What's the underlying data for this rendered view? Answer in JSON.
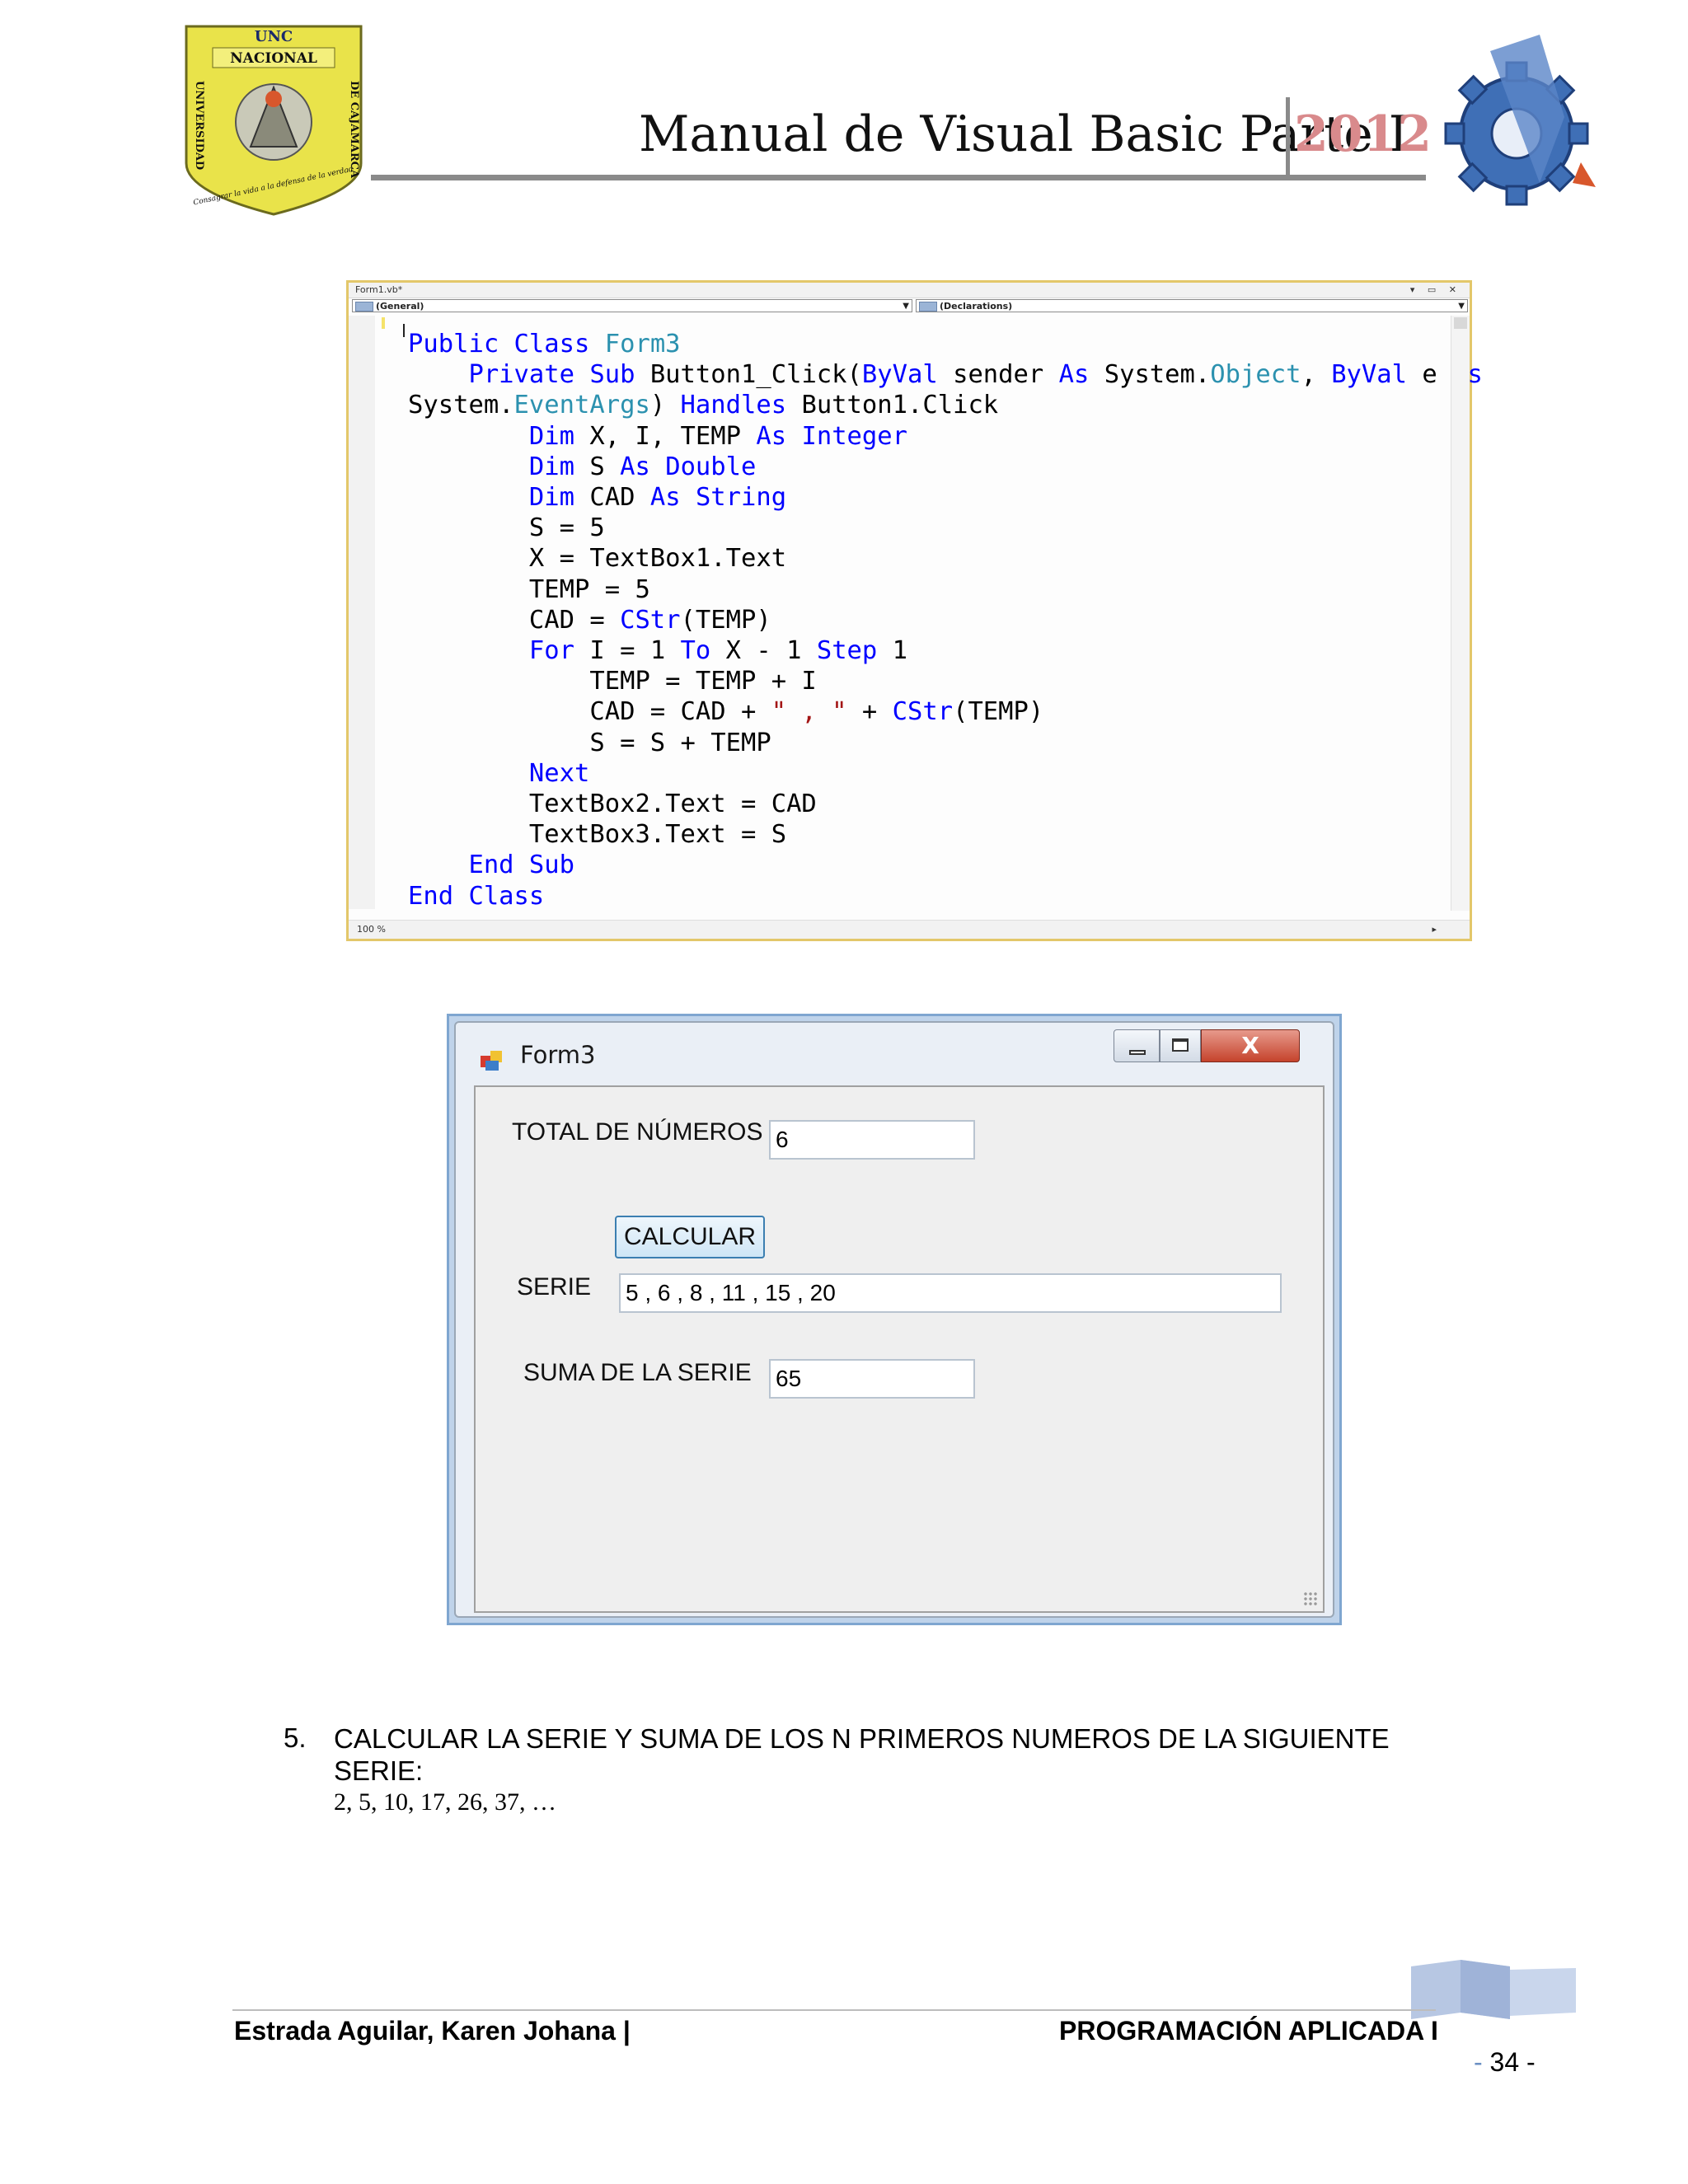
{
  "header": {
    "title": "Manual de Visual Basic Parte I",
    "year": "2012",
    "logo_left": {
      "icon": "unc-university-crest",
      "text_top": "UNC",
      "text_band": "NACIONAL",
      "text_left": "UNIVERSIDAD",
      "text_right": "DE CAJAMARCA",
      "motto": "Consagrar la vida a la defensa de la verdad"
    },
    "logo_right": {
      "icon": "systems-engineering-gear-emblem"
    }
  },
  "editor": {
    "tab_title": "Form1.vb*",
    "left_combo": "(General)",
    "right_combo": "(Declarations)",
    "zoom": "100 %",
    "code_lines": [
      [
        {
          "t": "Public ",
          "c": "kw"
        },
        {
          "t": "Class ",
          "c": "kw"
        },
        {
          "t": "Form3",
          "c": "ty"
        }
      ],
      [
        {
          "t": "    "
        },
        {
          "t": "Private ",
          "c": "kw"
        },
        {
          "t": "Sub ",
          "c": "kw"
        },
        {
          "t": "Button1_Click("
        },
        {
          "t": "ByVal",
          "c": "kw"
        },
        {
          "t": " sender "
        },
        {
          "t": "As",
          "c": "kw"
        },
        {
          "t": " System."
        },
        {
          "t": "Object",
          "c": "ty"
        },
        {
          "t": ", "
        },
        {
          "t": "ByVal",
          "c": "kw"
        },
        {
          "t": " e "
        },
        {
          "t": "As",
          "c": "kw"
        }
      ],
      [
        {
          "t": "System."
        },
        {
          "t": "EventArgs",
          "c": "ty"
        },
        {
          "t": ") "
        },
        {
          "t": "Handles",
          "c": "kw"
        },
        {
          "t": " Button1.Click"
        }
      ],
      [
        {
          "t": "        "
        },
        {
          "t": "Dim",
          "c": "kw"
        },
        {
          "t": " X, I, TEMP "
        },
        {
          "t": "As",
          "c": "kw"
        },
        {
          "t": " "
        },
        {
          "t": "Integer",
          "c": "kw"
        }
      ],
      [
        {
          "t": "        "
        },
        {
          "t": "Dim",
          "c": "kw"
        },
        {
          "t": " S "
        },
        {
          "t": "As",
          "c": "kw"
        },
        {
          "t": " "
        },
        {
          "t": "Double",
          "c": "kw"
        }
      ],
      [
        {
          "t": "        "
        },
        {
          "t": "Dim",
          "c": "kw"
        },
        {
          "t": " CAD "
        },
        {
          "t": "As",
          "c": "kw"
        },
        {
          "t": " "
        },
        {
          "t": "String",
          "c": "kw"
        }
      ],
      [
        {
          "t": "        S = 5"
        }
      ],
      [
        {
          "t": "        X = TextBox1.Text"
        }
      ],
      [
        {
          "t": "        TEMP = 5"
        }
      ],
      [
        {
          "t": "        CAD = "
        },
        {
          "t": "CStr",
          "c": "kw"
        },
        {
          "t": "(TEMP)"
        }
      ],
      [
        {
          "t": "        "
        },
        {
          "t": "For",
          "c": "kw"
        },
        {
          "t": " I = 1 "
        },
        {
          "t": "To",
          "c": "kw"
        },
        {
          "t": " X - 1 "
        },
        {
          "t": "Step",
          "c": "kw"
        },
        {
          "t": " 1"
        }
      ],
      [
        {
          "t": "            TEMP = TEMP + I"
        }
      ],
      [
        {
          "t": "            CAD = CAD + "
        },
        {
          "t": "\" , \"",
          "c": "st"
        },
        {
          "t": " + "
        },
        {
          "t": "CStr",
          "c": "kw"
        },
        {
          "t": "(TEMP)"
        }
      ],
      [
        {
          "t": "            S = S + TEMP"
        }
      ],
      [
        {
          "t": "        "
        },
        {
          "t": "Next",
          "c": "kw"
        }
      ],
      [
        {
          "t": "        TextBox2.Text = CAD"
        }
      ],
      [
        {
          "t": "        TextBox3.Text = S"
        }
      ],
      [
        {
          "t": "    "
        },
        {
          "t": "End ",
          "c": "kw"
        },
        {
          "t": "Sub",
          "c": "kw"
        }
      ],
      [
        {
          "t": "End ",
          "c": "kw"
        },
        {
          "t": "Class",
          "c": "kw"
        }
      ]
    ]
  },
  "form": {
    "title": "Form3",
    "total_label": "TOTAL DE NÚMEROS",
    "total_value": "6",
    "button_label": "CALCULAR",
    "serie_label": "SERIE",
    "serie_value": "5 , 6 , 8 , 11 , 15 , 20",
    "suma_label": "SUMA DE LA SERIE",
    "suma_value": "65",
    "close_glyph": "X"
  },
  "exercise": {
    "number": "5.",
    "text": "CALCULAR LA SERIE Y SUMA DE LOS N PRIMEROS NUMEROS DE LA SIGUIENTE SERIE:",
    "series": "2, 5, 10, 17, 26, 37,   …"
  },
  "footer": {
    "author": "Estrada Aguilar, Karen Johana |",
    "course": "PROGRAMACIÓN APLICADA I",
    "page_number": "34",
    "page_dash_left": "-",
    "page_dash_right": "-"
  },
  "colors": {
    "keyword": "#0000ff",
    "type": "#2b91af",
    "string": "#a31515",
    "year": "#d98a8c",
    "editor_border": "#e3c76a",
    "window_accent": "#7fa6d0"
  }
}
